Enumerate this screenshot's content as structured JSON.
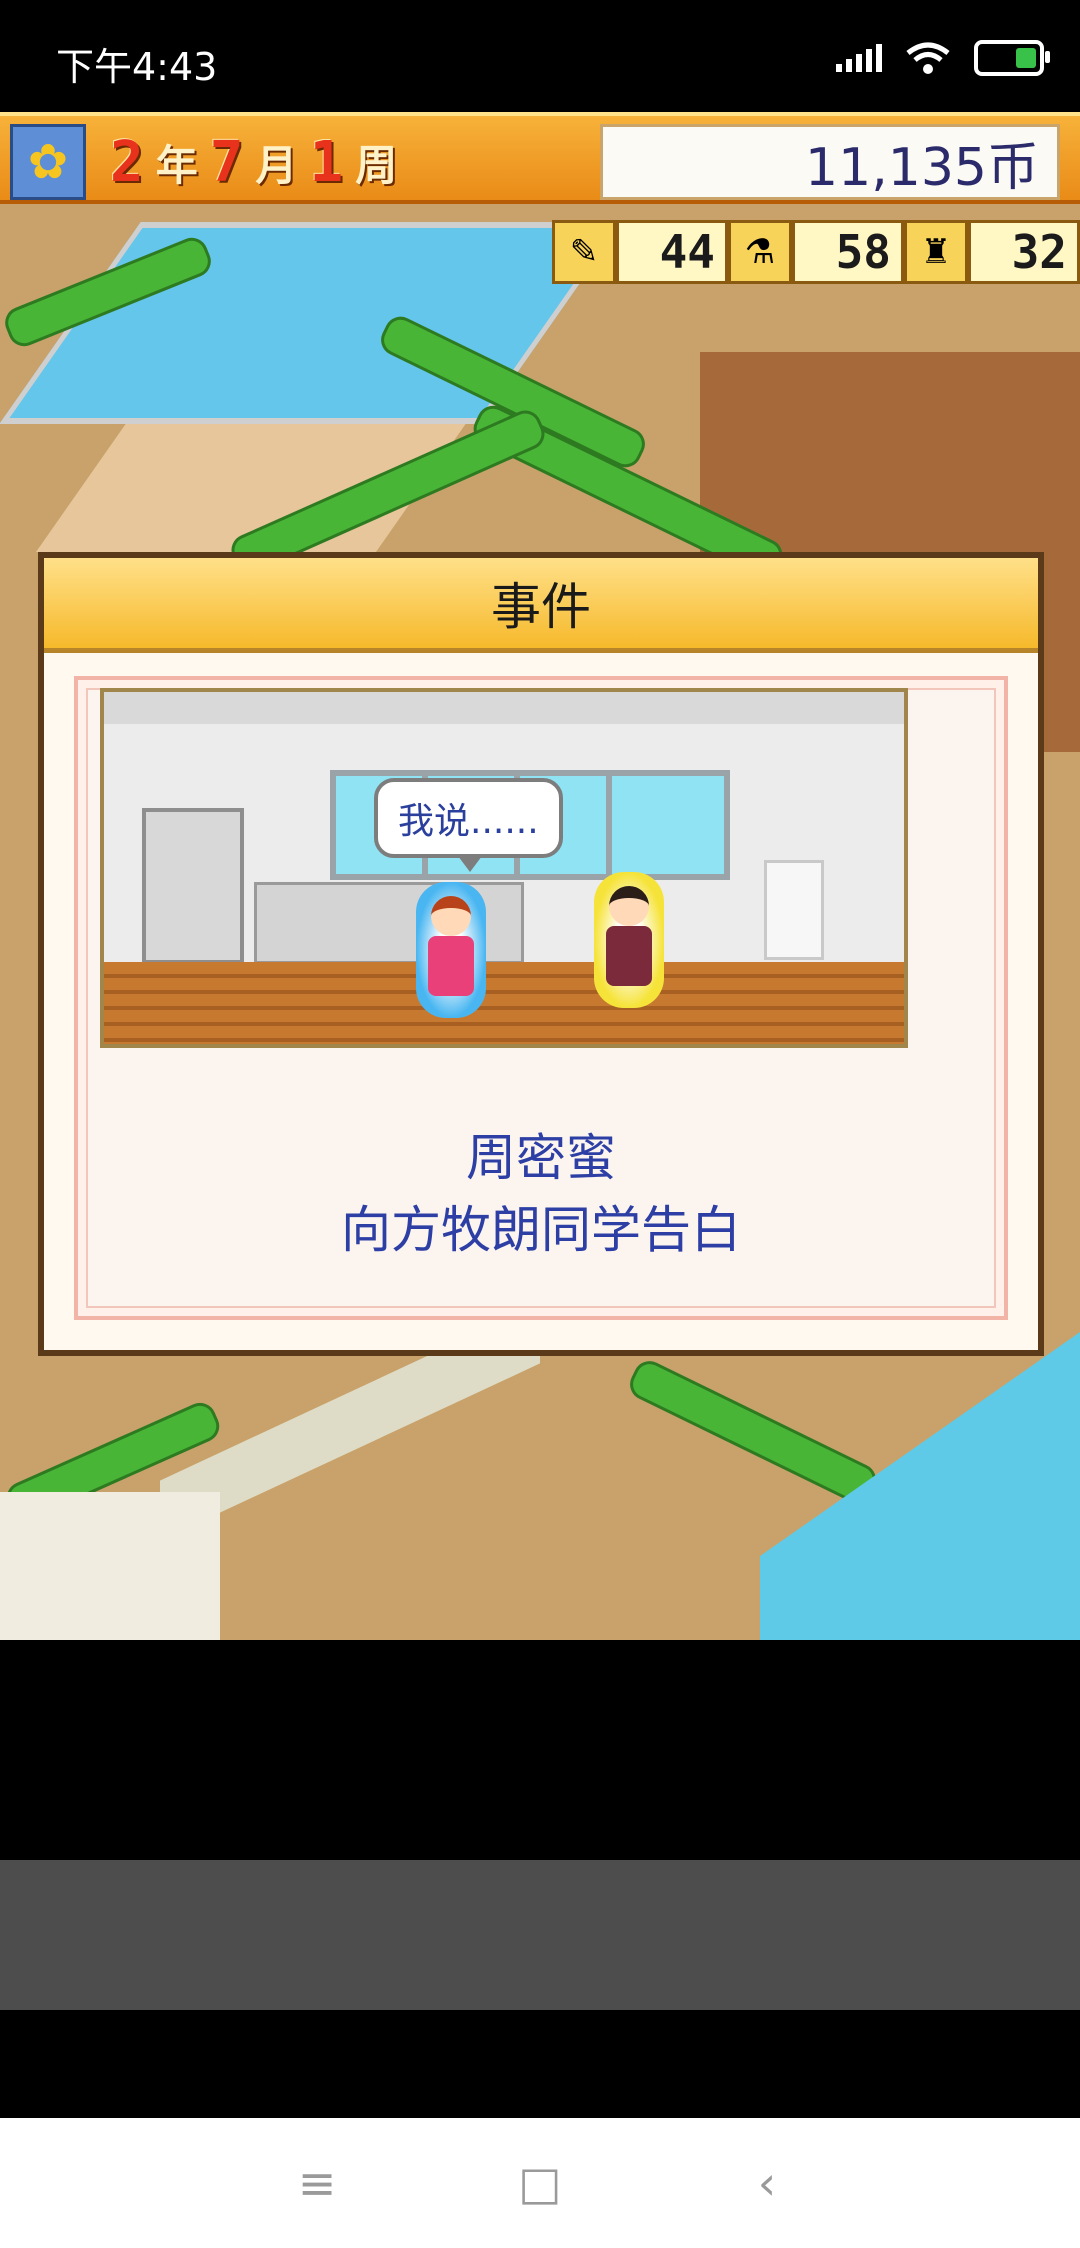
{
  "status_bar": {
    "time": "下午4:43"
  },
  "hud": {
    "date": {
      "year": "2",
      "year_unit": "年",
      "month": "7",
      "month_unit": "月",
      "week": "1",
      "week_unit": "周"
    },
    "money": "11,135币",
    "stats": [
      {
        "icon": "pencil-icon",
        "value": "44"
      },
      {
        "icon": "flask-icon",
        "value": "58"
      },
      {
        "icon": "trophy-icon",
        "value": "32"
      }
    ]
  },
  "event_dialog": {
    "title": "事件",
    "speech_bubble": "我说......",
    "line_1": "周密蜜",
    "line_2": "向方牧朗同学告白"
  },
  "bottom_bar": {
    "up_button_icon": "triangle-up-icon"
  },
  "nav_bar": {
    "menu": "≡",
    "home": "□",
    "back": "‹"
  },
  "colors": {
    "hud_orange": "#f0a02a",
    "dialog_text": "#2d3fa4",
    "money_text": "#2b2a6b"
  }
}
